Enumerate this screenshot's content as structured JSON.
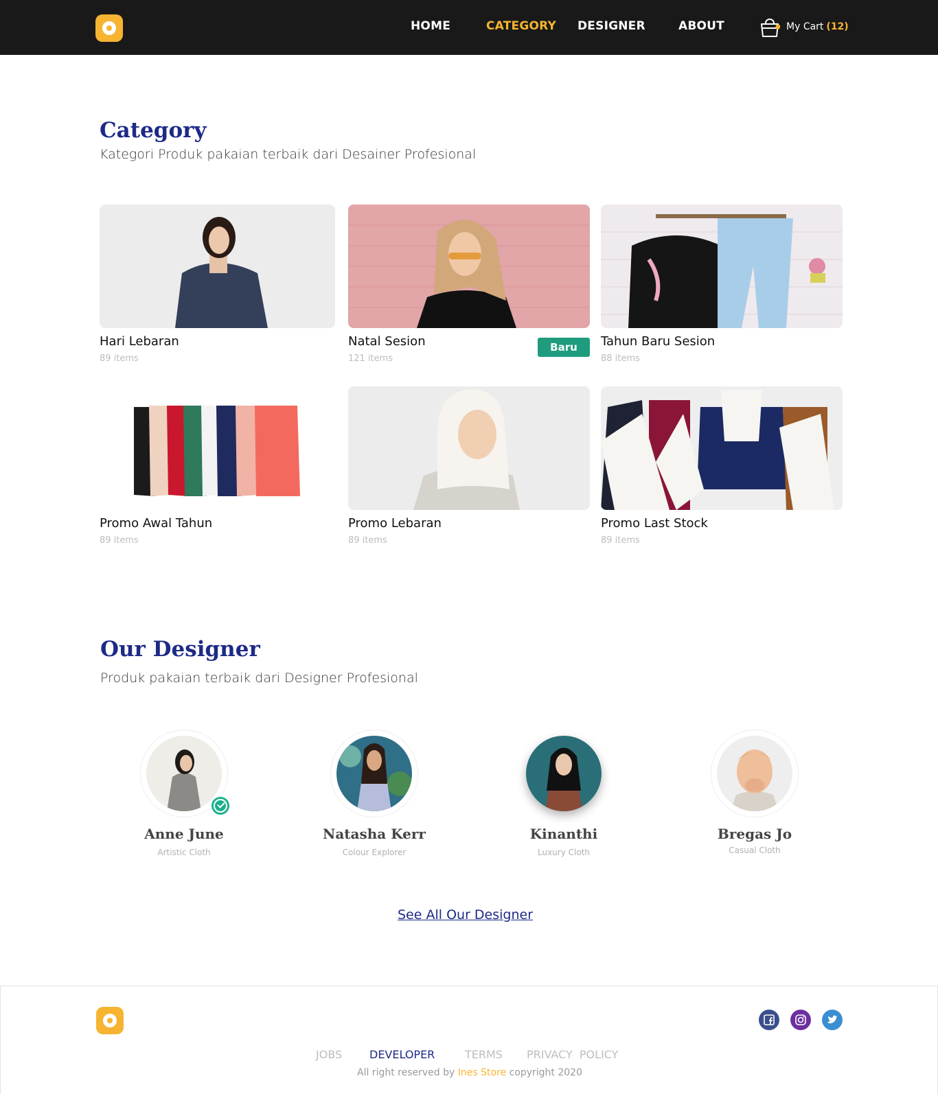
{
  "colors": {
    "accent": "#f6b431",
    "navy": "#1d2a86",
    "navbar_bg": "#191919",
    "badge_green": "#1f9c7e"
  },
  "nav": {
    "links": [
      {
        "label": "HOME",
        "active": false
      },
      {
        "label": "CATEGORY",
        "active": true
      },
      {
        "label": "DESIGNER",
        "active": false
      },
      {
        "label": "ABOUT",
        "active": false
      }
    ],
    "cart_label": "My Cart",
    "cart_count": "(12)",
    "cart_icon": "shopping-bag-icon"
  },
  "category": {
    "title": "Category",
    "subtitle": "Kategori Produk pakaian terbaik dari Desainer Profesional",
    "cards": [
      {
        "name": "Hari Lebaran",
        "count": "89 items"
      },
      {
        "name": "Natal Sesion",
        "count": "121 items",
        "badge": "Baru"
      },
      {
        "name": "Tahun Baru Sesion",
        "count": "88 items"
      },
      {
        "name": "Promo Awal Tahun",
        "count": "89 items"
      },
      {
        "name": "Promo Lebaran",
        "count": "89 items"
      },
      {
        "name": "Promo Last Stock",
        "count": "89 items"
      }
    ]
  },
  "designers": {
    "title": "Our Designer",
    "subtitle": "Produk pakaian terbaik dari Designer Profesional",
    "items": [
      {
        "name": "Anne June",
        "role": "Artistic Cloth",
        "verified": true
      },
      {
        "name": "Natasha Kerr",
        "role": "Colour Explorer",
        "verified": false
      },
      {
        "name": "Kinanthi",
        "role": "Luxury Cloth",
        "verified": false
      },
      {
        "name": "Bregas Jo",
        "role": "Casual Cloth",
        "verified": false
      }
    ],
    "see_all": "See All Our Designer"
  },
  "footer": {
    "links": [
      {
        "label": "JOBS",
        "active": false
      },
      {
        "label": "DEVELOPER",
        "active": true
      },
      {
        "label": "TERMS",
        "active": false
      },
      {
        "label": "PRIVACY  POLICY",
        "active": false
      }
    ],
    "copyright_prefix": "All right reserved by",
    "brand": "Ines Store",
    "copyright_suffix": "copyright 2020",
    "social": [
      "facebook-icon",
      "instagram-icon",
      "twitter-icon"
    ]
  }
}
